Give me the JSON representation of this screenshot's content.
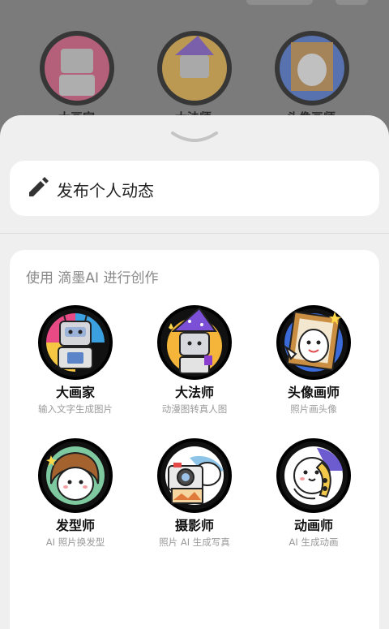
{
  "background": {
    "labels": [
      "大画家",
      "大法师",
      "头像画师"
    ]
  },
  "post": {
    "label": "发布个人动态",
    "icon": "pencil-icon"
  },
  "section": {
    "title": "使用 滴墨AI 进行创作"
  },
  "tools": [
    {
      "name": "大画家",
      "desc": "输入文字生成图片",
      "icon": "robot-painter-icon"
    },
    {
      "name": "大法师",
      "desc": "动漫图转真人图",
      "icon": "robot-wizard-icon"
    },
    {
      "name": "头像画师",
      "desc": "照片画头像",
      "icon": "ghost-frame-icon"
    },
    {
      "name": "发型师",
      "desc": "AI 照片换发型",
      "icon": "hairstylist-icon"
    },
    {
      "name": "摄影师",
      "desc": "照片 AI 生成写真",
      "icon": "camera-icon"
    },
    {
      "name": "动画师",
      "desc": "AI 生成动画",
      "icon": "animator-icon"
    }
  ],
  "colors": {
    "sheet": "#efefef",
    "card": "#ffffff",
    "overlay": "#7b7b7b"
  }
}
